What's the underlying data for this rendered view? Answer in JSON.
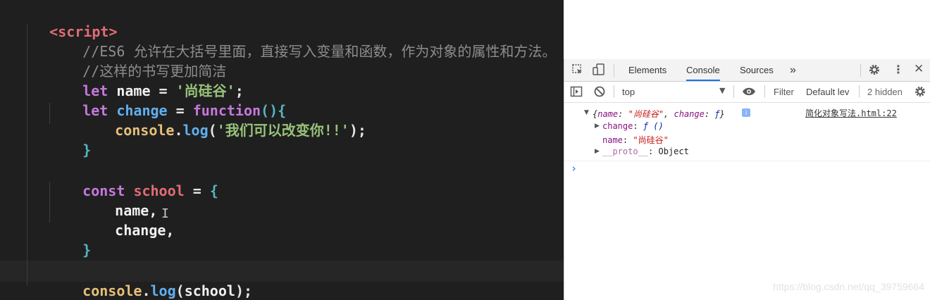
{
  "editor": {
    "lines": {
      "l1": [
        "<script>"
      ],
      "l2": [
        "//ES6 允许在大括号里面，直接写入变量和函数，作为对象的属性和方法。"
      ],
      "l3": [
        "//这样的书写更加简洁"
      ],
      "l4": [
        "let",
        " ",
        "name",
        " = ",
        "'尚硅谷'",
        ";"
      ],
      "l5": [
        "let",
        " ",
        "change",
        " = ",
        "function",
        "(){"
      ],
      "l6": [
        "console",
        ".",
        "log",
        "(",
        "'我们可以改变你!!'",
        ");"
      ],
      "l7": [
        "}"
      ],
      "l8": [
        "const",
        " ",
        "school",
        " = ",
        "{"
      ],
      "l9": [
        "name,"
      ],
      "l10": [
        "change,"
      ],
      "l11": [
        "}"
      ],
      "l12": [
        "console",
        ".",
        "log",
        "(",
        "school",
        ");"
      ]
    },
    "caret": "I"
  },
  "devtools": {
    "tabs": [
      "Elements",
      "Console",
      "Sources",
      "»"
    ],
    "active_tab": "Console",
    "context": "top",
    "filter_placeholder": "Filter",
    "levels": "Default lev",
    "hidden": "2 hidden",
    "log": {
      "summary_open": "{",
      "summary_k1": "name",
      "summary_v1": "\"尚硅谷\"",
      "summary_k2": "change",
      "summary_v2": "ƒ",
      "summary_close": "}",
      "source": "简化对象写法.html:22",
      "prop1_key": "change",
      "prop1_val": "ƒ ()",
      "prop2_key": "name",
      "prop2_val": "\"尚硅谷\"",
      "prop3_key": "__proto__",
      "prop3_val": "Object"
    },
    "prompt": "›"
  },
  "watermark": "https://blog.csdn.net/qq_39759664",
  "colors": {
    "editor_bg": "#1f1f1f",
    "keyword": "#c678dd",
    "string": "#98c379",
    "function": "#61afef",
    "tag": "#e06c75",
    "active_tab_underline": "#1a73e8"
  }
}
